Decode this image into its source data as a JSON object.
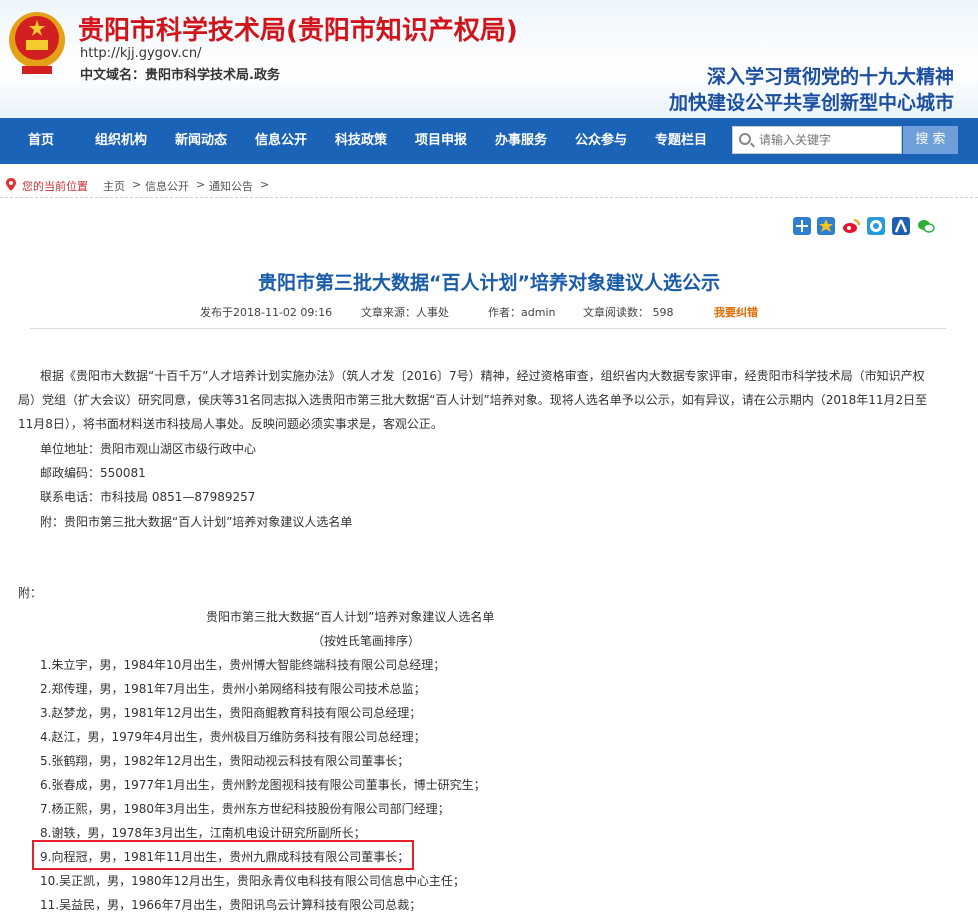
{
  "header": {
    "title": "贵阳市科学技术局(贵阳市知识产权局)",
    "url": "http://kjj.gygov.cn/",
    "domain": "中文域名：贵阳市科学技术局.政务",
    "slogan_1": "深入学习贯彻党的十九大精神",
    "slogan_2": "加快建设公平共享创新型中心城市"
  },
  "nav": {
    "items": [
      "首页",
      "组织机构",
      "新闻动态",
      "信息公开",
      "科技政策",
      "项目申报",
      "办事服务",
      "公众参与",
      "专题栏目"
    ],
    "search_placeholder": "请输入关键字",
    "search_button": "搜 索"
  },
  "breadcrumb": {
    "label": "您的当前位置",
    "items": [
      "主页",
      "信息公开",
      "通知公告"
    ],
    "separator": ">"
  },
  "share_icons": [
    "add-share-icon",
    "favorite-icon",
    "weibo-icon",
    "qq-share-icon",
    "renren-icon",
    "wechat-icon"
  ],
  "article": {
    "title": "贵阳市第三批大数据“百人计划”培养对象建议人选公示",
    "published": "发布于2018-11-02 09:16",
    "source": "文章来源：人事处",
    "author": "作者：admin",
    "reads": "文章阅读数： 598",
    "report_error": "我要纠错",
    "body_line1": "根据《贵阳市大数据“十百千万”人才培养计划实施办法》（筑人才发〔2016〕7号）精神，经过资格审查，组织省内大数据专家评审，经贵阳市科学技术局（市知识产权",
    "body_line2": "局）党组（扩大会议）研究同意，侯庆等31名同志拟入选贵阳市第三批大数据“百人计划”培养对象。现将人选名单予以公示，如有异议，请在公示期内（2018年11月2日至",
    "body_line3": "11月8日），将书面材料送市科技局人事处。反映问题必须实事求是，客观公正。",
    "address": "单位地址：贵阳市观山湖区市级行政中心",
    "postcode": "邮政编码：550081",
    "phone": "联系电话：市科技局 0851—87989257",
    "attachment": "附：贵阳市第三批大数据“百人计划”培养对象建议人选名单",
    "appendix_label": "附：",
    "list_title": "贵阳市第三批大数据“百人计划”培养对象建议人选名单",
    "list_subtitle": "（按姓氏笔画排序）",
    "candidates": [
      "1.朱立宇，男，1984年10月出生，贵州博大智能终端科技有限公司总经理；",
      "2.郑传理，男，1981年7月出生，贵州小弟网络科技有限公司技术总监；",
      "3.赵梦龙，男，1981年12月出生，贵阳商鲲教育科技有限公司总经理；",
      "4.赵江，男，1979年4月出生，贵州极目万维防务科技有限公司总经理；",
      "5.张鹤翔，男，1982年12月出生，贵阳动视云科技有限公司董事长；",
      "6.张春成，男，1977年1月出生，贵州黔龙图视科技有限公司董事长，博士研究生；",
      "7.杨正熙，男，1980年3月出生，贵州东方世纪科技股份有限公司部门经理；",
      "8.谢轶，男，1978年3月出生，江南机电设计研究所副所长；",
      "9.向程冠，男，1981年11月出生，贵州九鼎成科技有限公司董事长；",
      "10.吴正凯，男，1980年12月出生，贵阳永青仪电科技有限公司信息中心主任；",
      "11.吴益民，男，1966年7月出生，贵阳讯鸟云计算科技有限公司总裁；"
    ]
  },
  "colors": {
    "nav_bg": "#1a63b7",
    "title_red": "#d0141b",
    "article_title_blue": "#1a5ca8",
    "highlight_red": "#e5202a"
  }
}
